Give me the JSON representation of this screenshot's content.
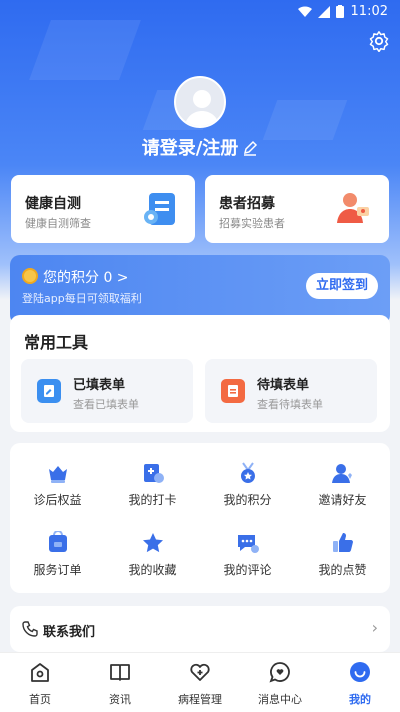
{
  "status": {
    "time": "11:02"
  },
  "profile": {
    "login_text": "请登录/注册"
  },
  "cards": [
    {
      "title": "健康自测",
      "sub": "健康自测筛查"
    },
    {
      "title": "患者招募",
      "sub": "招募实验患者"
    }
  ],
  "points": {
    "title": "您的积分 0",
    "sub": "登陆app每日可领取福利",
    "button": "立即签到"
  },
  "tools": {
    "heading": "常用工具",
    "items": [
      {
        "title": "已填表单",
        "sub": "查看已填表单"
      },
      {
        "title": "待填表单",
        "sub": "查看待填表单"
      }
    ]
  },
  "grid": [
    "诊后权益",
    "我的打卡",
    "我的积分",
    "邀请好友",
    "服务订单",
    "我的收藏",
    "我的评论",
    "我的点赞"
  ],
  "contact": {
    "label": "联系我们"
  },
  "tabs": [
    "首页",
    "资讯",
    "病程管理",
    "消息中心",
    "我的"
  ],
  "colors": {
    "primary": "#2f6bf0",
    "active_tab": "#2f6bf0"
  }
}
